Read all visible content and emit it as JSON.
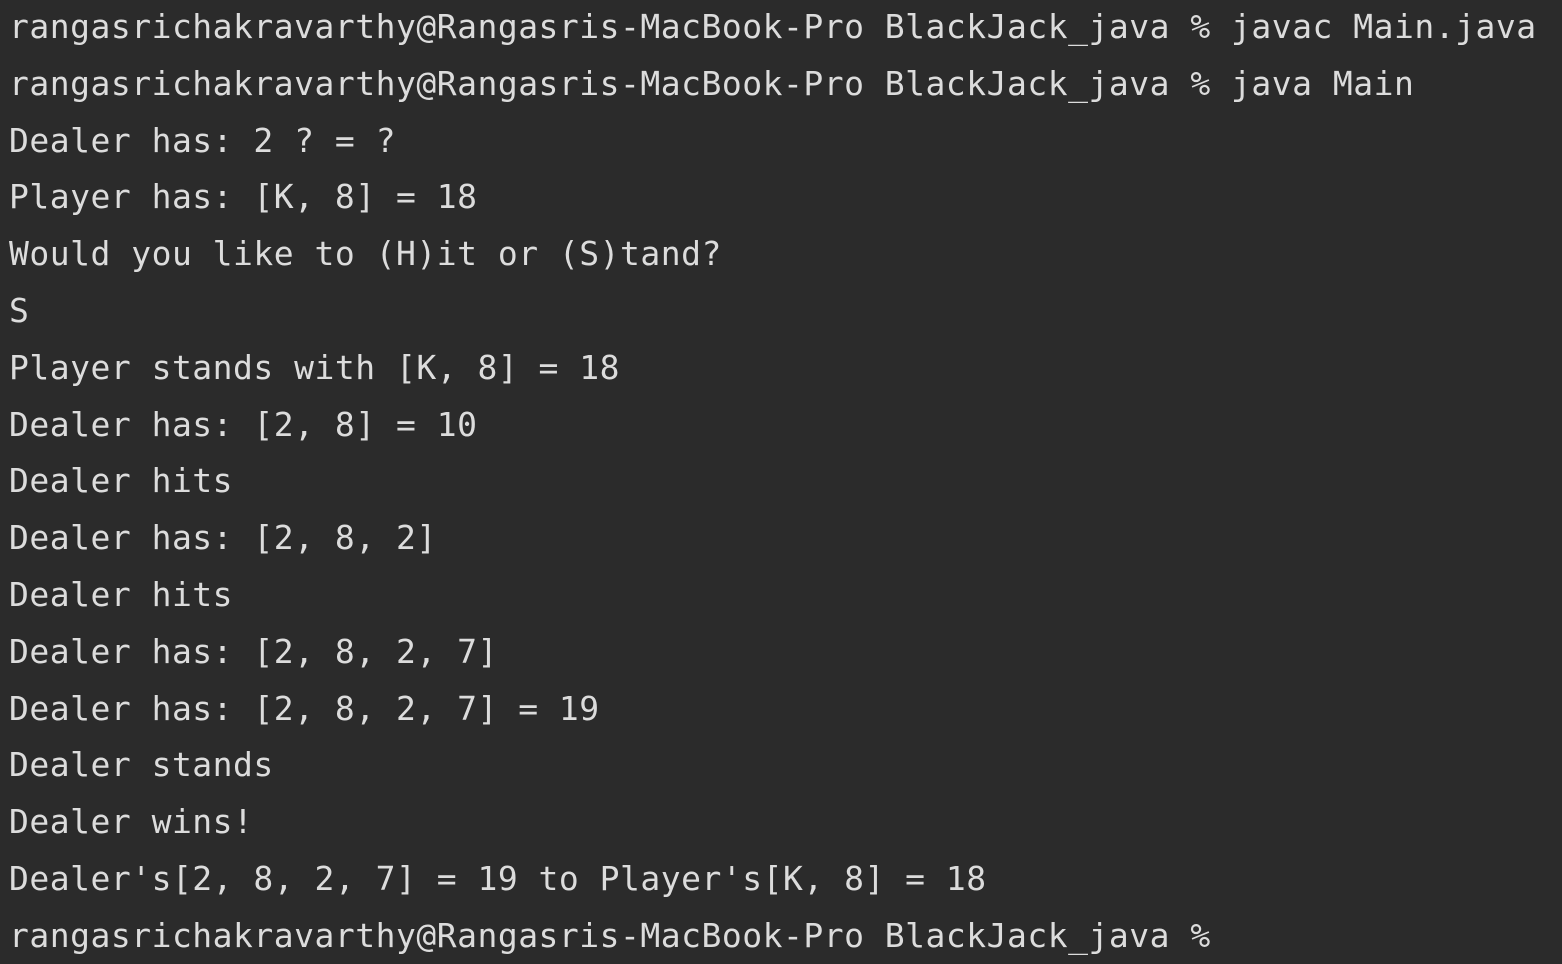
{
  "terminal": {
    "background": "#2b2b2b",
    "foreground": "#dcdcdc",
    "lines": [
      "rangasrichakravarthy@Rangasris-MacBook-Pro BlackJack_java % javac Main.java",
      "rangasrichakravarthy@Rangasris-MacBook-Pro BlackJack_java % java Main",
      "Dealer has: 2 ? = ?",
      "Player has: [K, 8] = 18",
      "Would you like to (H)it or (S)tand?",
      "S",
      "Player stands with [K, 8] = 18",
      "Dealer has: [2, 8] = 10",
      "Dealer hits",
      "Dealer has: [2, 8, 2]",
      "Dealer hits",
      "Dealer has: [2, 8, 2, 7]",
      "Dealer has: [2, 8, 2, 7] = 19",
      "Dealer stands",
      "Dealer wins!",
      "Dealer's[2, 8, 2, 7] = 19 to Player's[K, 8] = 18",
      "rangasrichakravarthy@Rangasris-MacBook-Pro BlackJack_java % "
    ]
  }
}
